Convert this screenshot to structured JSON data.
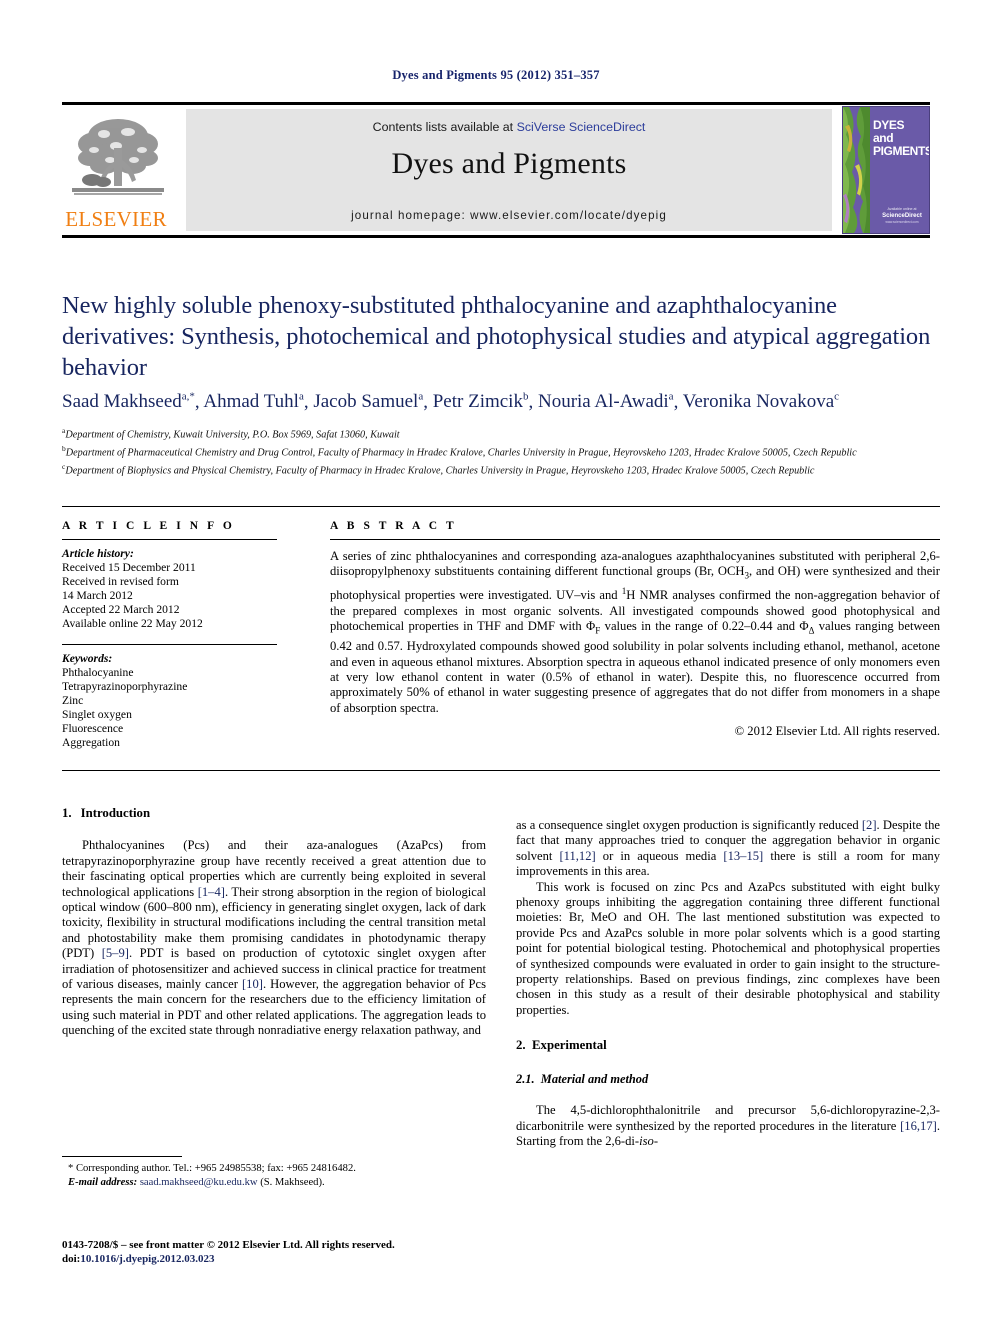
{
  "running_head": "Dyes and Pigments 95 (2012) 351–357",
  "journal_header": {
    "contents_prefix": "Contents lists available at ",
    "sciencedirect_link": "SciVerse ScienceDirect",
    "journal_title": "Dyes and Pigments",
    "homepage": "journal homepage: www.elsevier.com/locate/dyepig",
    "publisher_logo_text": "ELSEVIER",
    "publisher_logo_icon": "elsevier-tree-icon",
    "accent_link_color": "#2c3d9b",
    "band_color": "#e4e4e4",
    "logo_orange": "#f07f13"
  },
  "cover": {
    "line1": "DYES",
    "line2": "and",
    "line3": "PIGMENTS",
    "footer_small": "Available online at",
    "footer_brand": "ScienceDirect",
    "footer_url": "www.sciencedirect.com",
    "background_color": "#6a5aa8"
  },
  "article": {
    "title": "New highly soluble phenoxy-substituted phthalocyanine and azaphthalocyanine derivatives: Synthesis, photochemical and photophysical studies and atypical aggregation behavior",
    "title_color": "#17255f",
    "authors": [
      {
        "name": "Saad Makhseed",
        "marks": "a,*"
      },
      {
        "name": "Ahmad Tuhl",
        "marks": "a"
      },
      {
        "name": "Jacob Samuel",
        "marks": "a"
      },
      {
        "name": "Petr Zimcik",
        "marks": "b"
      },
      {
        "name": "Nouria Al-Awadi",
        "marks": "a"
      },
      {
        "name": "Veronika Novakova",
        "marks": "c"
      }
    ],
    "affiliations": [
      {
        "mark": "a",
        "text": "Department of Chemistry, Kuwait University, P.O. Box 5969, Safat 13060, Kuwait"
      },
      {
        "mark": "b",
        "text": "Department of Pharmaceutical Chemistry and Drug Control, Faculty of Pharmacy in Hradec Kralove, Charles University in Prague, Heyrovskeho 1203, Hradec Kralove 50005, Czech Republic"
      },
      {
        "mark": "c",
        "text": "Department of Biophysics and Physical Chemistry, Faculty of Pharmacy in Hradec Kralove, Charles University in Prague, Heyrovskeho 1203, Hradec Kralove 50005, Czech Republic"
      }
    ]
  },
  "article_info": {
    "heading": "A R T I C L E   I N F O",
    "history_label": "Article history:",
    "history": [
      "Received 15 December 2011",
      "Received in revised form",
      "14 March 2012",
      "Accepted 22 March 2012",
      "Available online 22 May 2012"
    ],
    "keywords_label": "Keywords:",
    "keywords": [
      "Phthalocyanine",
      "Tetrapyrazinoporphyrazine",
      "Zinc",
      "Singlet oxygen",
      "Fluorescence",
      "Aggregation"
    ]
  },
  "abstract": {
    "heading": "A B S T R A C T",
    "p1_a": "A series of zinc phthalocyanines and corresponding aza-analogues azaphthalocyanines substituted with peripheral 2,6-diisopropylphenoxy substituents containing different functional groups (Br, OCH",
    "p1_sub1": "3",
    "p1_b": ", and OH) were synthesized and their photophysical properties were investigated. UV–vis and ",
    "p1_sup1": "1",
    "p1_c": "H NMR analyses confirmed the non-aggregation behavior of the prepared complexes in most organic solvents. All investigated compounds showed good photophysical and photochemical properties in THF and DMF with Φ",
    "p1_subF": "F",
    "p1_d": " values in the range of 0.22–0.44 and Φ",
    "p1_subD": "Δ",
    "p1_e": " values ranging between 0.42 and 0.57. Hydroxylated compounds showed good solubility in polar solvents including ethanol, methanol, acetone and even in aqueous ethanol mixtures. Absorption spectra in aqueous ethanol indicated presence of only monomers even at very low ethanol content in water (0.5% of ethanol in water). Despite this, no fluorescence occurred from approximately 50% of ethanol in water suggesting presence of aggregates that do not differ from monomers in a shape of absorption spectra.",
    "copyright": "© 2012 Elsevier Ltd. All rights reserved."
  },
  "body": {
    "intro_num": "1.",
    "intro_title": "Introduction",
    "intro_p1_a": "Phthalocyanines (Pcs) and their aza-analogues (AzaPcs) from tetrapyrazinoporphyrazine group have recently received a great attention due to their fascinating optical properties which are currently being exploited in several technological applications ",
    "intro_p1_ref1": "[1–4]",
    "intro_p1_b": ". Their strong absorption in the region of biological optical window (600–800 nm), efficiency in generating singlet oxygen, lack of dark toxicity, flexibility in structural modifications including the central transition metal and photostability make them promising candidates in photodynamic therapy (PDT) ",
    "intro_p1_ref2": "[5–9]",
    "intro_p1_c": ". PDT is based on production of cytotoxic singlet oxygen after irradiation of photosensitizer and achieved success in clinical practice for treatment of various diseases, mainly cancer ",
    "intro_p1_ref3": "[10]",
    "intro_p1_d": ". However, the aggregation behavior of Pcs represents the main concern for the researchers due to the efficiency limitation of using such material in PDT and other related applications. The aggregation leads to quenching of the excited state through nonradiative energy relaxation pathway, and",
    "right_p1_a": "as a consequence singlet oxygen production is significantly reduced ",
    "right_p1_ref1": "[2]",
    "right_p1_b": ". Despite the fact that many approaches tried to conquer the aggregation behavior in organic solvent ",
    "right_p1_ref2": "[11,12]",
    "right_p1_c": " or in aqueous media ",
    "right_p1_ref3": "[13–15]",
    "right_p1_d": " there is still a room for many improvements in this area.",
    "right_p2": "This work is focused on zinc Pcs and AzaPcs substituted with eight bulky phenoxy groups inhibiting the aggregation containing three different functional moieties: Br, MeO and OH. The last mentioned substitution was expected to provide Pcs and AzaPcs soluble in more polar solvents which is a good starting point for potential biological testing. Photochemical and photophysical properties of synthesized compounds were evaluated in order to gain insight to the structure-property relationships. Based on previous findings, zinc complexes have been chosen in this study as a result of their desirable photophysical and stability properties.",
    "exp_num": "2.",
    "exp_title": "Experimental",
    "exp_sub_num": "2.1.",
    "exp_sub_title": "Material and method",
    "exp_p1_a": "The 4,5-dichlorophthalonitrile and precursor 5,6-dichloropyrazine-2,3-dicarbonitrile were synthesized by the reported procedures in the literature ",
    "exp_p1_ref": "[16,17]",
    "exp_p1_b": ". Starting from the 2,6-di-",
    "exp_p1_ital": "iso",
    "exp_p1_c": "-"
  },
  "footnote": {
    "corresponding": "* Corresponding author. Tel.: +965 24985538; fax: +965 24816482.",
    "email_label": "E-mail address:",
    "email": "saad.makhseed@ku.edu.kw",
    "email_suffix": "(S. Makhseed).",
    "link_color": "#17255f"
  },
  "imprint": {
    "line1": "0143-7208/$ – see front matter © 2012 Elsevier Ltd. All rights reserved.",
    "doi_label": "doi:",
    "doi": "10.1016/j.dyepig.2012.03.023"
  }
}
